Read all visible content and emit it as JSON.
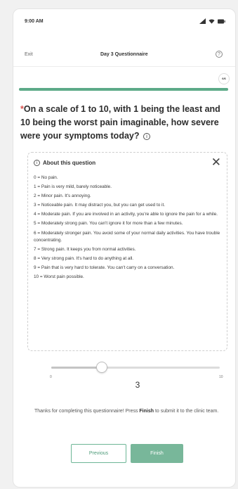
{
  "status_bar": {
    "time": "9:00 AM",
    "icons": [
      "signal-icon",
      "wifi-icon",
      "battery-icon"
    ]
  },
  "header": {
    "exit_label": "Exit",
    "title": "Day 3 Questionnaire",
    "help_icon": "help-circle-icon",
    "help_glyph": "?"
  },
  "progress": {
    "counter": "6/6",
    "fraction": 1.0,
    "color": "#5daa88"
  },
  "question": {
    "required_mark": "*",
    "text": "On a scale of 1 to 10, with 1 being the least and 10 being the worst pain imaginable, how severe were your symptoms today?",
    "info_glyph": "i"
  },
  "about": {
    "title": "About this question",
    "info_glyph": "i",
    "close_glyph": "✕",
    "items": [
      "0 = No pain.",
      "1 = Pain is very mild, barely noticeable.",
      "2 = Minor pain. It's annoying.",
      "3 = Noticeable pain. It may distract you, but you can get used to it.",
      "4 = Moderate pain. If you are involved in an activity, you're able to ignore the pain for a while.",
      "5 = Moderately strong pain. You can't ignore it for more than a few minutes.",
      "6 = Moderately stronger pain. You avoid some of your normal daily activities. You have trouble concentrating.",
      "7 = Strong pain. It keeps you from normal activities.",
      "8 = Very strong pain. It's hard to do anything at all.",
      "9 = Pain that is very hard to tolerate. You can't carry on a conversation.",
      "10 = Worst pain possible."
    ]
  },
  "slider": {
    "min": 0,
    "max": 10,
    "min_label": "0",
    "max_label": "10",
    "value": 3,
    "value_label": "3"
  },
  "thanks": {
    "prefix": "Thanks for completing this questionnaire! Press ",
    "bold": "Finish",
    "suffix": " to submit it to the clinic team."
  },
  "buttons": {
    "previous_label": "Previous",
    "finish_label": "Finish",
    "accent": "#78b79a"
  }
}
